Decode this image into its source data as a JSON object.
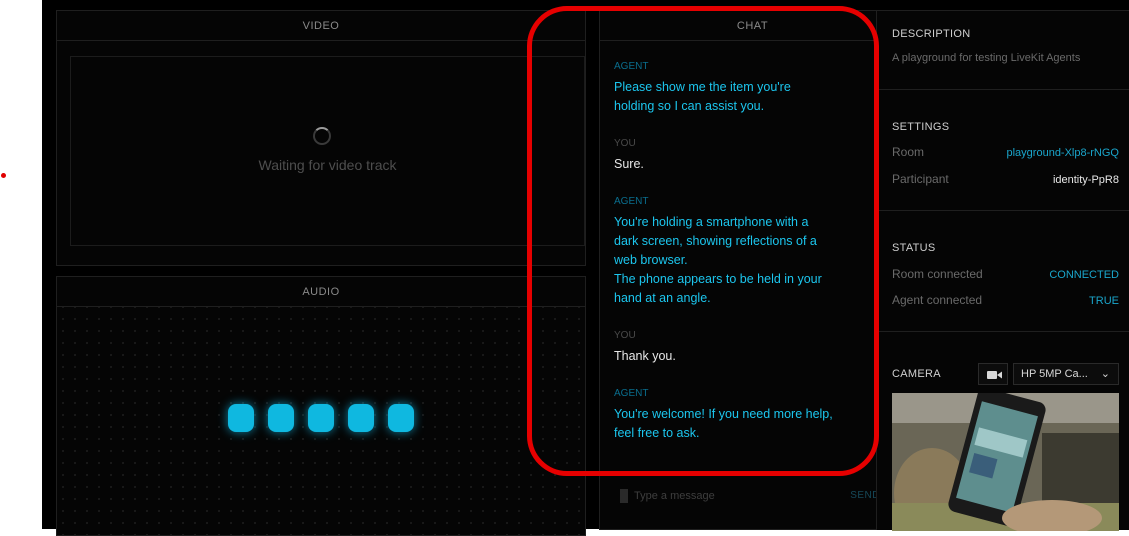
{
  "video": {
    "title": "VIDEO",
    "waiting": "Waiting for video track"
  },
  "audio": {
    "title": "AUDIO",
    "bar_color": "#0fb8e0"
  },
  "chat": {
    "title": "CHAT",
    "messages": [
      {
        "sender": "AGENT",
        "lines": [
          "Please show me the item you're",
          "holding so I can assist you."
        ]
      },
      {
        "sender": "YOU",
        "lines": [
          "Sure."
        ]
      },
      {
        "sender": "AGENT",
        "lines": [
          "You're holding a smartphone with a",
          "dark screen, showing reflections of a",
          "web browser.",
          "The phone appears to be held in your",
          "hand at an angle."
        ]
      },
      {
        "sender": "YOU",
        "lines": [
          "Thank you."
        ]
      },
      {
        "sender": "AGENT",
        "lines": [
          "You're welcome! If you need more help,",
          "feel free to ask."
        ]
      }
    ],
    "input_placeholder": "Type a message",
    "send_label": "SEND"
  },
  "sidebar": {
    "description": {
      "title": "DESCRIPTION",
      "text": "A playground for testing LiveKit Agents"
    },
    "settings": {
      "title": "SETTINGS",
      "room_label": "Room",
      "room_value": "playground-Xlp8-rNGQ",
      "participant_label": "Participant",
      "participant_value": "identity-PpR8"
    },
    "status": {
      "title": "STATUS",
      "room_label": "Room connected",
      "room_value": "CONNECTED",
      "agent_label": "Agent connected",
      "agent_value": "TRUE"
    },
    "camera": {
      "title": "CAMERA",
      "device": "HP 5MP Ca...",
      "icon": "video-camera-icon"
    }
  },
  "colors": {
    "accent": "#1aa6cc",
    "agent_text": "#1cc6ee",
    "highlight": "#e60000"
  }
}
